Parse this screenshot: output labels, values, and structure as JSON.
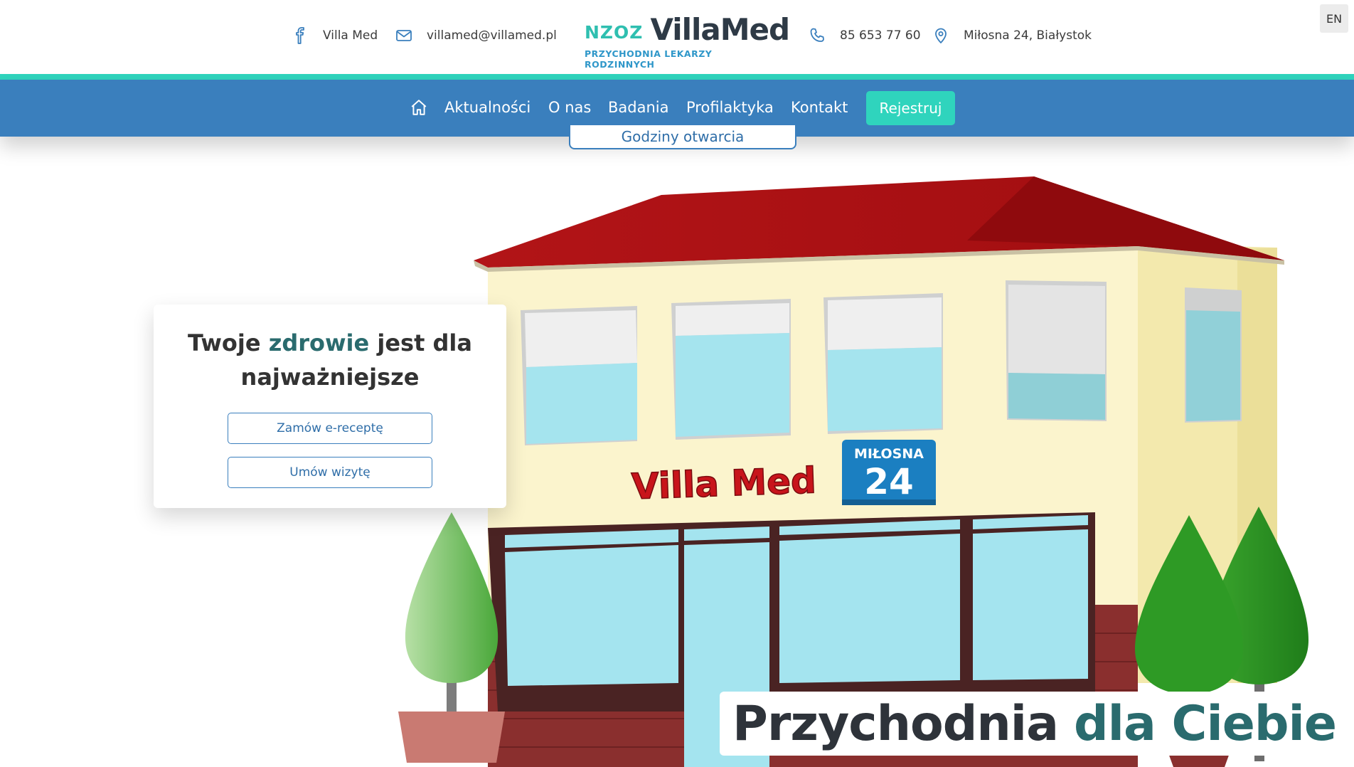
{
  "topbar": {
    "facebook_label": "Villa Med",
    "email": "villamed@villamed.pl",
    "phone": "85 653 77 60",
    "address": "Miłosna 24, Białystok",
    "lang_button": "EN"
  },
  "logo": {
    "prefix": "NZOZ",
    "brand": "VillaMed",
    "subtitle": "PRZYCHODNIA LEKARZY RODZINNYCH"
  },
  "nav": {
    "items": [
      "Aktualności",
      "O nas",
      "Badania",
      "Profilaktyka",
      "Kontakt"
    ],
    "register": "Rejestruj",
    "hours_tab": "Godziny otwarcia"
  },
  "hero": {
    "title_part1": "Twoje ",
    "title_accent": "zdrowie",
    "title_part2": " jest dla najważniejsze",
    "button_prescription": "Zamów e-receptę",
    "button_visit": "Umów wizytę",
    "tagline_part1": "Przychodnia",
    "tagline_accent": "dla Ciebie",
    "building_sign": "Villa Med",
    "street_sign_name": "MIŁOSNA",
    "street_sign_number": "24"
  },
  "colors": {
    "nav_blue": "#3a7fbd",
    "teal_accent": "#2fd4bd",
    "dark_teal_text": "#2a6b6e",
    "roof_red": "#a30e12"
  }
}
